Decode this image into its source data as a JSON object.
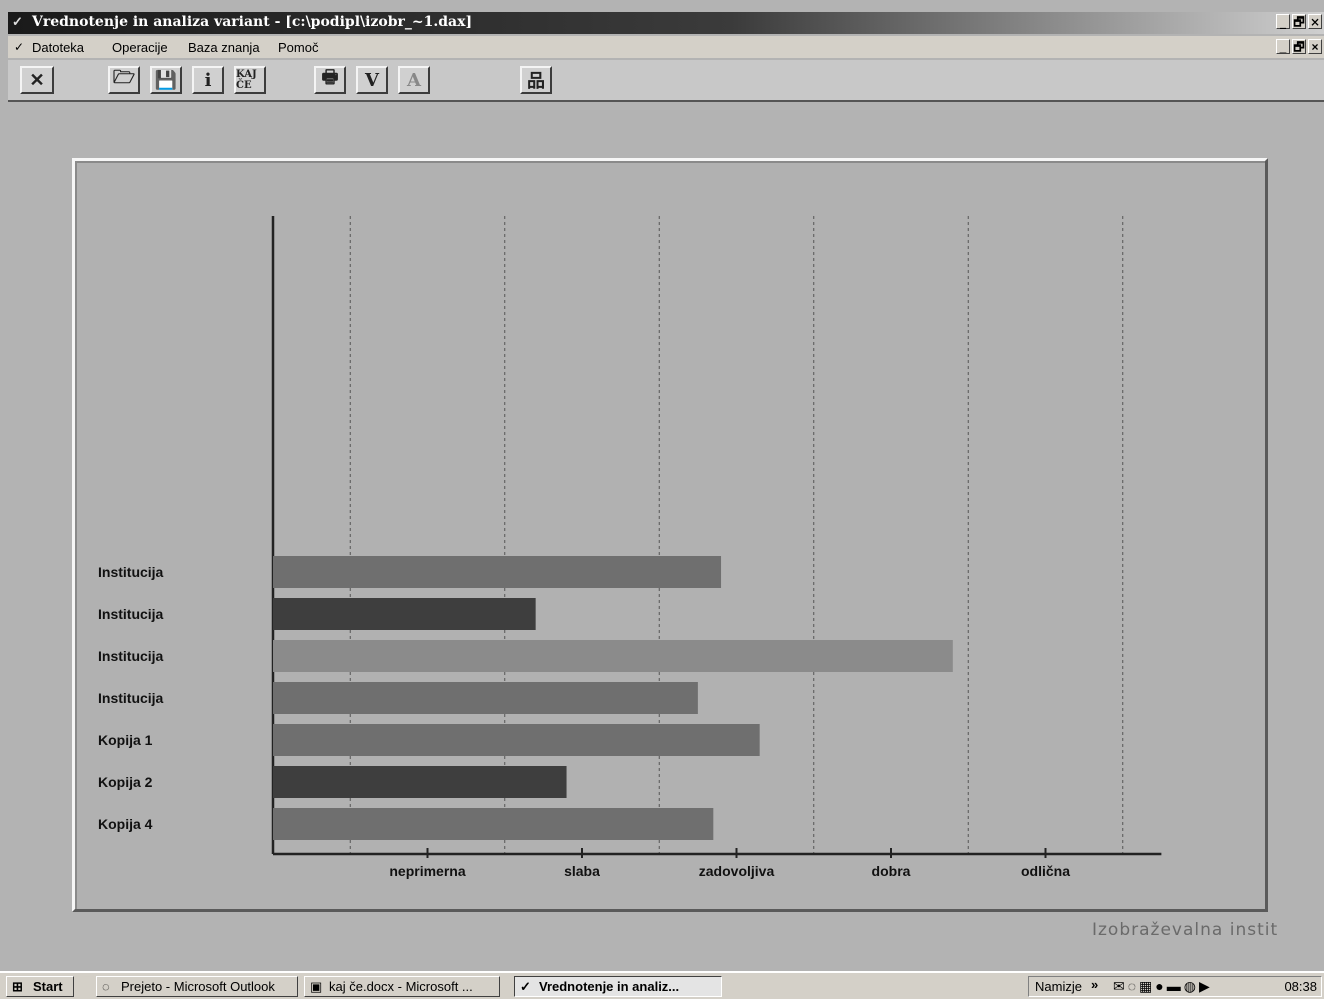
{
  "window": {
    "title": "Vrednotenje in analiza variant - [c:\\podipl\\izobr_~1.dax]",
    "controls": [
      "_",
      "🗗",
      "×"
    ]
  },
  "menubar": {
    "items": [
      "Datoteka",
      "Operacije",
      "Baza znanja",
      "Pomoč"
    ]
  },
  "toolbar": {
    "buttons": [
      {
        "name": "close-doc",
        "glyph": "✕",
        "icon": "close-icon"
      },
      {
        "name": "open",
        "glyph": "🗁",
        "icon": "open-folder-icon"
      },
      {
        "name": "save",
        "glyph": "💾",
        "icon": "save-icon"
      },
      {
        "name": "info",
        "glyph": "i",
        "icon": "info-icon"
      },
      {
        "name": "kaj-ce",
        "glyph": "KAJ ČE",
        "icon": "kaj-ce-icon"
      },
      {
        "name": "print",
        "glyph": "🖶",
        "icon": "print-icon"
      },
      {
        "name": "v",
        "glyph": "V",
        "icon": "v-icon"
      },
      {
        "name": "a",
        "glyph": "A",
        "icon": "a-icon"
      },
      {
        "name": "tree",
        "glyph": "品",
        "icon": "tree-icon"
      }
    ]
  },
  "chart_data": {
    "type": "bar",
    "orientation": "horizontal",
    "categories": [
      "Institucija",
      "Institucija",
      "Institucija",
      "Institucija",
      "Kopija 1",
      "Kopija 2",
      "Kopija 4"
    ],
    "values": [
      2.9,
      1.7,
      4.4,
      2.75,
      3.15,
      1.9,
      2.85
    ],
    "x_tick_labels": [
      "neprimerna",
      "slaba",
      "zadovoljiva",
      "dobra",
      "odlična"
    ],
    "xlim": [
      0,
      5.75
    ],
    "grid": true,
    "legend": "none",
    "bar_colors": [
      "#6f6f6f",
      "#3e3e3e",
      "#8b8b8b",
      "#6f6f6f",
      "#6f6f6f",
      "#3e3e3e",
      "#6f6f6f"
    ]
  },
  "caption": "Izobraževalna instit",
  "taskbar": {
    "start_label": "Start",
    "tasks": [
      {
        "label": "Prejeto - Microsoft Outlook",
        "active": false
      },
      {
        "label": "kaj če.docx - Microsoft ...",
        "active": false
      },
      {
        "label": "Vrednotenje in analiz...",
        "active": true
      }
    ],
    "desktop_label": "Namizje",
    "clock": "08:38"
  }
}
